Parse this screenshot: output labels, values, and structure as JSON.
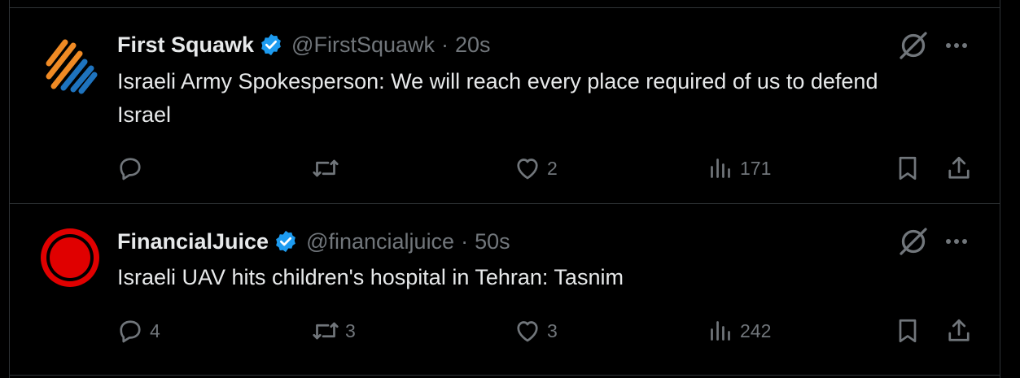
{
  "tweets": [
    {
      "name": "First Squawk",
      "handle": "@FirstSquawk",
      "separator": "·",
      "time": "20s",
      "text": "Israeli Army Spokesperson: We will reach every place required of us to defend Israel",
      "reply_count": "",
      "retweet_count": "",
      "like_count": "2",
      "view_count": "171"
    },
    {
      "name": "FinancialJuice",
      "handle": "@financialjuice",
      "separator": "·",
      "time": "50s",
      "text": "Israeli UAV hits children's hospital in Tehran: Tasnim",
      "reply_count": "4",
      "retweet_count": "3",
      "like_count": "3",
      "view_count": "242"
    }
  ],
  "colors": {
    "background": "#000000",
    "text": "#e7e9ea",
    "muted": "#71767b",
    "border": "#2f3336",
    "verified_blue": "#1d9bf0",
    "first_squawk_orange": "#f08a24",
    "first_squawk_blue": "#1e73be",
    "financialjuice_red": "#e00000"
  },
  "icons": [
    "grok-icon",
    "more-icon",
    "reply-icon",
    "retweet-icon",
    "like-icon",
    "views-icon",
    "bookmark-icon",
    "share-icon",
    "verified-badge-icon"
  ]
}
